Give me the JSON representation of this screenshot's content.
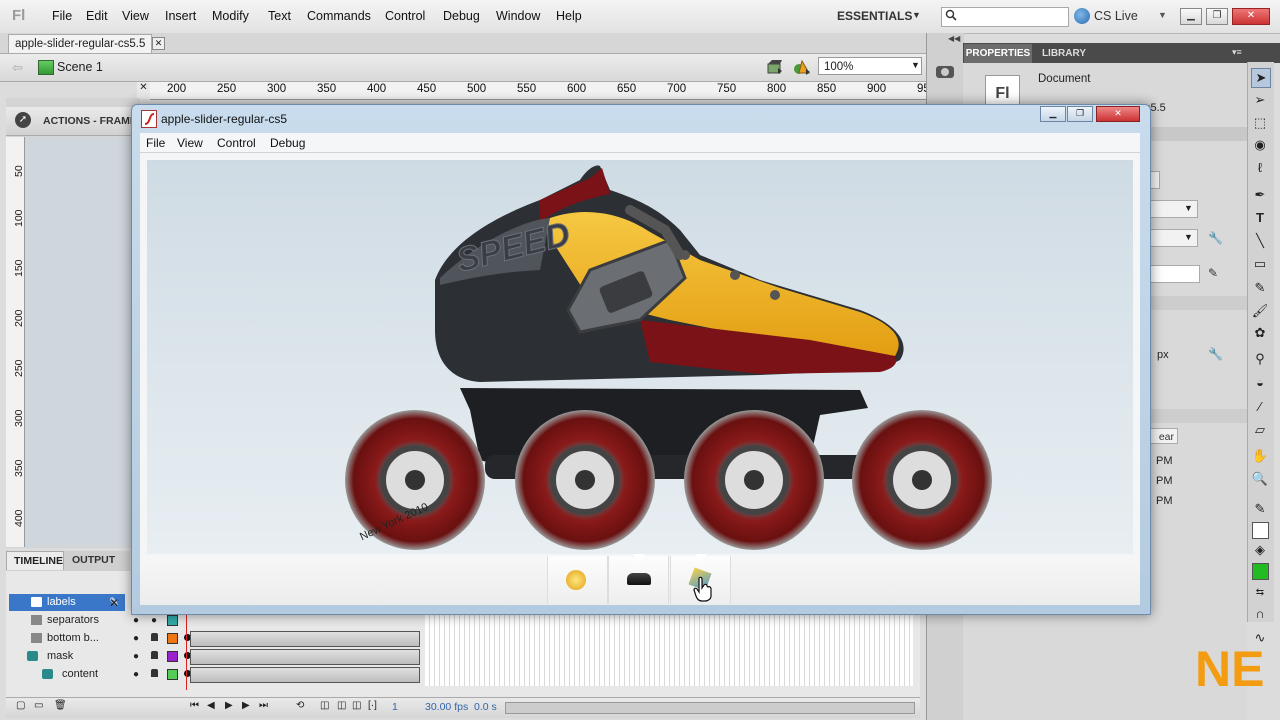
{
  "app": {
    "logo_text": "Fl",
    "menu": [
      "File",
      "Edit",
      "View",
      "Insert",
      "Modify",
      "Text",
      "Commands",
      "Control",
      "Debug",
      "Window",
      "Help"
    ],
    "workspace": "ESSENTIALS",
    "search_placeholder": "",
    "cslive": "CS Live"
  },
  "document": {
    "tab_label": "apple-slider-regular-cs5.5",
    "scene": "Scene 1",
    "zoom": "100%"
  },
  "ruler": {
    "top": [
      "200",
      "250",
      "300",
      "350",
      "400",
      "450",
      "500",
      "550",
      "600",
      "650",
      "700",
      "750",
      "800",
      "850",
      "900",
      "95"
    ],
    "left": [
      "50",
      "100",
      "150",
      "200",
      "250",
      "300",
      "350",
      "400"
    ]
  },
  "actions_panel": {
    "label": "ACTIONS - FRAME"
  },
  "timeline": {
    "tabs": [
      "TIMELINE",
      "OUTPUT"
    ],
    "layers": [
      {
        "name": "labels",
        "color": "#33aaaa",
        "selected": true
      },
      {
        "name": "separators",
        "color": "#33aaaa",
        "selected": false
      },
      {
        "name": "bottom b...",
        "color": "#ee7711",
        "selected": false
      },
      {
        "name": "mask",
        "color": "#9922cc",
        "selected": false
      },
      {
        "name": "content",
        "color": "#55cc55",
        "selected": false
      }
    ],
    "frame": "1",
    "fps": "30.00 fps",
    "time": "0.0 s"
  },
  "properties_panel": {
    "tabs": [
      "PROPERTIES",
      "LIBRARY"
    ],
    "doc_icon": "Fl",
    "doc_type": "Document",
    "file_frag": "s5.5",
    "unit_frag": "px",
    "button_frag": "ear",
    "time_frags": [
      "PM",
      "PM",
      "PM"
    ]
  },
  "player": {
    "title": "apple-slider-regular-cs5",
    "menu": [
      "File",
      "View",
      "Control",
      "Debug"
    ],
    "thumbnails": [
      "thumb-1",
      "thumb-2",
      "thumb-3"
    ],
    "skate_text": "SPEED",
    "wheel_text": "New York 2010"
  },
  "colors": {
    "shoe_yellow": "#f2b71c",
    "shoe_dark": "#2c2f33",
    "shoe_red": "#7a1218",
    "wheel_red": "#8a1a1a",
    "ne_logo": "#f39c12"
  },
  "watermark": {
    "text": "NE"
  }
}
